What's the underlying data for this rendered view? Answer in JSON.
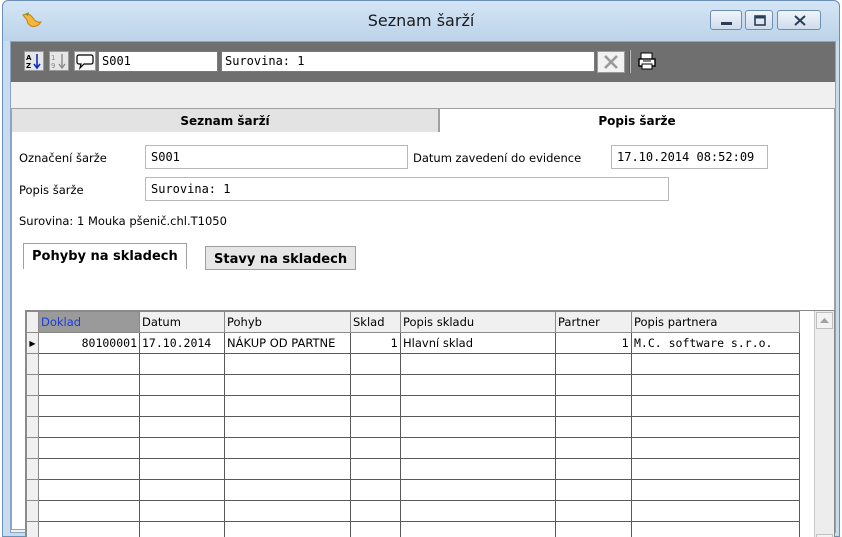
{
  "window": {
    "title": "Seznam šarží"
  },
  "toolbar": {
    "code_value": "S001",
    "name_value": "Surovina: 1"
  },
  "top_tabs": [
    "Seznam šarží",
    "Popis šarže"
  ],
  "form": {
    "oznaceni_label": "Označení šarže",
    "oznaceni_value": "S001",
    "datum_label": "Datum zavedení do evidence",
    "datum_value": "17.10.2014 08:52:09",
    "popis_label": "Popis šarže",
    "popis_value": "Surovina: 1",
    "surovina_text": "Surovina: 1 Mouka pšenič.chl.T1050"
  },
  "inner_tabs": [
    "Pohyby na skladech",
    "Stavy na skladech"
  ],
  "grid": {
    "columns": [
      "Doklad",
      "Datum",
      "Pohyb",
      "Sklad",
      "Popis skladu",
      "Partner",
      "Popis partnera"
    ],
    "rows": [
      [
        "80100001",
        "17.10.2014",
        "NÁKUP OD PARTNE",
        "1",
        "Hlavní sklad",
        "1",
        "M.C. software s.r.o."
      ]
    ]
  },
  "icons": {
    "app": "app-icon",
    "minimize": "minimize-icon",
    "maximize": "maximize-icon",
    "close": "close-icon",
    "sort_az": "sort-az-icon",
    "sort_19": "sort-19-icon",
    "comment": "comment-icon",
    "clear": "clear-x-icon",
    "print": "printer-icon"
  }
}
